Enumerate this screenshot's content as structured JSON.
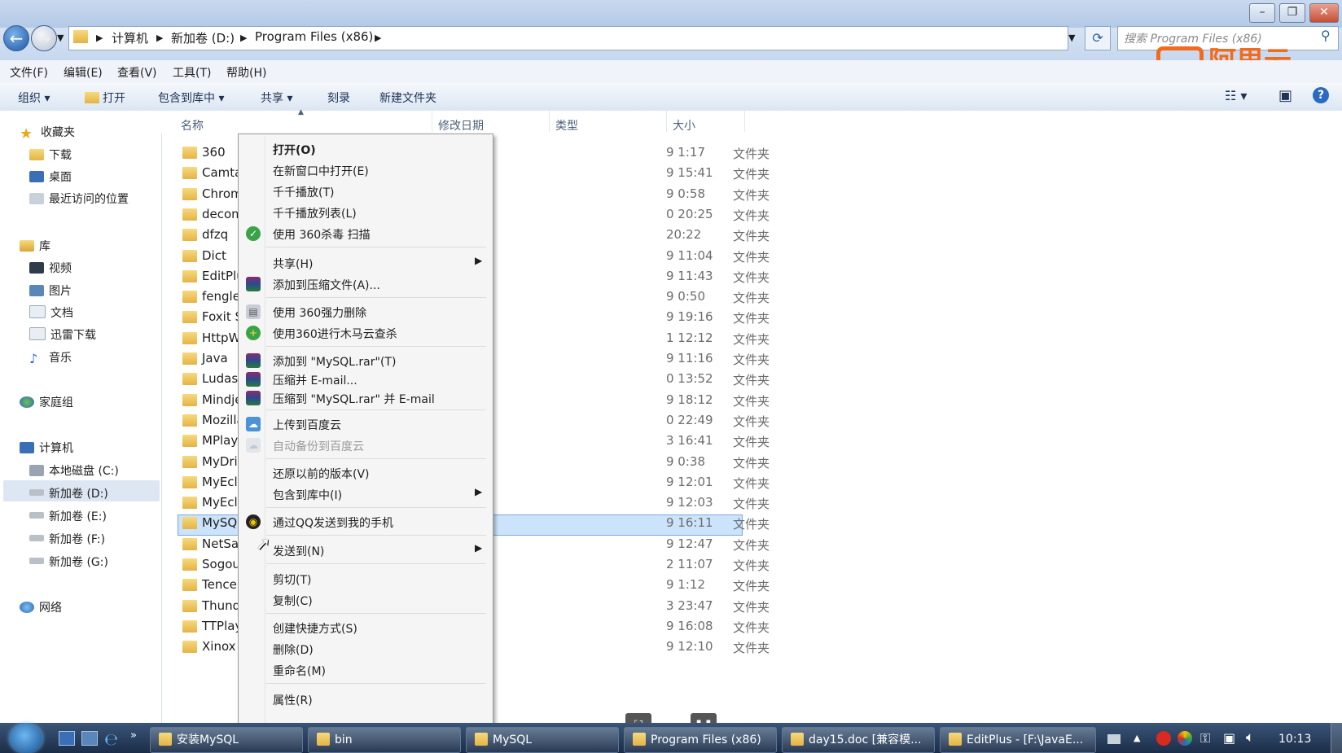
{
  "window": {
    "search_placeholder": "搜索 Program Files (x86)",
    "watermark": "阿里云"
  },
  "breadcrumb": [
    "计算机",
    "新加卷 (D:)",
    "Program Files (x86)"
  ],
  "menubar": [
    "文件(F)",
    "编辑(E)",
    "查看(V)",
    "工具(T)",
    "帮助(H)"
  ],
  "toolbar": {
    "organize": "组织 ▾",
    "open": "打开",
    "include": "包含到库中 ▾",
    "share": "共享 ▾",
    "burn": "刻录",
    "new_folder": "新建文件夹"
  },
  "nav": {
    "favorites": "收藏夹",
    "downloads": "下载",
    "desktop": "桌面",
    "recent": "最近访问的位置",
    "libraries": "库",
    "videos": "视频",
    "pictures": "图片",
    "documents": "文档",
    "xunlei": "迅雷下载",
    "music": "音乐",
    "homegroup": "家庭组",
    "computer": "计算机",
    "drive_c": "本地磁盘 (C:)",
    "drive_d": "新加卷 (D:)",
    "drive_e": "新加卷 (E:)",
    "drive_f": "新加卷 (F:)",
    "drive_g": "新加卷 (G:)",
    "network": "网络"
  },
  "columns": {
    "name": "名称",
    "date": "修改日期",
    "type": "类型",
    "size": "大小"
  },
  "files": [
    {
      "name": "360",
      "date": "9 1:17",
      "type": "文件夹"
    },
    {
      "name": "Camta",
      "date": "9 15:41",
      "type": "文件夹"
    },
    {
      "name": "Chrom",
      "date": "9 0:58",
      "type": "文件夹"
    },
    {
      "name": "decom",
      "date": "0 20:25",
      "type": "文件夹"
    },
    {
      "name": "dfzq",
      "date": "20:22",
      "type": "文件夹"
    },
    {
      "name": "Dict",
      "date": "9 11:04",
      "type": "文件夹"
    },
    {
      "name": "EditPlu",
      "date": "9 11:43",
      "type": "文件夹"
    },
    {
      "name": "fenglei",
      "date": "9 0:50",
      "type": "文件夹"
    },
    {
      "name": "Foxit S",
      "date": "9 19:16",
      "type": "文件夹"
    },
    {
      "name": "HttpW",
      "date": "1 12:12",
      "type": "文件夹"
    },
    {
      "name": "Java",
      "date": "9 11:16",
      "type": "文件夹"
    },
    {
      "name": "Ludash",
      "date": "0 13:52",
      "type": "文件夹"
    },
    {
      "name": "Mindje",
      "date": "9 18:12",
      "type": "文件夹"
    },
    {
      "name": "Mozilla",
      "date": "0 22:49",
      "type": "文件夹"
    },
    {
      "name": "MPlaye",
      "date": "3 16:41",
      "type": "文件夹"
    },
    {
      "name": "MyDriv",
      "date": "9 0:38",
      "type": "文件夹"
    },
    {
      "name": "MyEcli",
      "date": "9 12:01",
      "type": "文件夹"
    },
    {
      "name": "MyEcli",
      "date": "9 12:03",
      "type": "文件夹"
    },
    {
      "name": "MySQL",
      "date": "9 16:11",
      "type": "文件夹"
    },
    {
      "name": "NetSar",
      "date": "9 12:47",
      "type": "文件夹"
    },
    {
      "name": "Sogou",
      "date": "2 11:07",
      "type": "文件夹"
    },
    {
      "name": "Tencer",
      "date": "9 1:12",
      "type": "文件夹"
    },
    {
      "name": "Thund",
      "date": "3 23:47",
      "type": "文件夹"
    },
    {
      "name": "TTPlay",
      "date": "9 16:08",
      "type": "文件夹"
    },
    {
      "name": "Xinox",
      "date": "9 12:10",
      "type": "文件夹"
    }
  ],
  "context_menu": {
    "open": "打开(O)",
    "open_new": "在新窗口中打开(E)",
    "ttplay": "千千播放(T)",
    "ttplay_list": "千千播放列表(L)",
    "scan360": "使用 360杀毒 扫描",
    "share": "共享(H)",
    "add_archive": "添加到压缩文件(A)...",
    "force_delete": "使用 360强力删除",
    "trojan_scan": "使用360进行木马云查杀",
    "add_rar": "添加到 \"MySQL.rar\"(T)",
    "compress_email": "压缩并 E-mail...",
    "compress_rar_email": "压缩到 \"MySQL.rar\" 并 E-mail",
    "upload_baidu": "上传到百度云",
    "auto_backup": "自动备份到百度云",
    "restore": "还原以前的版本(V)",
    "include_lib": "包含到库中(I)",
    "qq_send": "通过QQ发送到我的手机",
    "send_to": "发送到(N)",
    "cut": "剪切(T)",
    "copy": "复制(C)",
    "shortcut": "创建快捷方式(S)",
    "delete": "删除(D)",
    "rename": "重命名(M)",
    "properties": "属性(R)"
  },
  "taskbar": {
    "tasks": [
      "安装MySQL",
      "bin",
      "MySQL",
      "Program Files (x86)",
      "day15.doc [兼容模...",
      "EditPlus - [F:\\JavaE..."
    ],
    "time": "10:13"
  }
}
